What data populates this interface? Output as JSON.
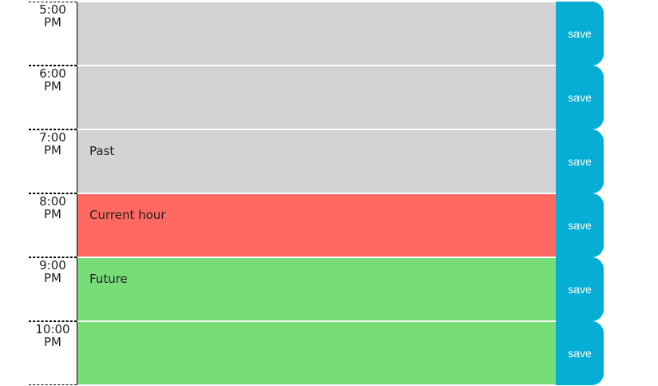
{
  "colors": {
    "past": "#d3d3d3",
    "present": "#ff6961",
    "future": "#77dd77",
    "save_button": "#06aed5"
  },
  "rows": [
    {
      "hour_time": "5:00",
      "hour_period": "PM",
      "text": "",
      "state": "past",
      "save_label": "save"
    },
    {
      "hour_time": "6:00",
      "hour_period": "PM",
      "text": "",
      "state": "past",
      "save_label": "save"
    },
    {
      "hour_time": "7:00",
      "hour_period": "PM",
      "text": "Past",
      "state": "past",
      "save_label": "save"
    },
    {
      "hour_time": "8:00",
      "hour_period": "PM",
      "text": "Current hour",
      "state": "present",
      "save_label": "save"
    },
    {
      "hour_time": "9:00",
      "hour_period": "PM",
      "text": "Future",
      "state": "future",
      "save_label": "save"
    },
    {
      "hour_time": "10:00",
      "hour_period": "PM",
      "text": "",
      "state": "future",
      "save_label": "save"
    }
  ]
}
